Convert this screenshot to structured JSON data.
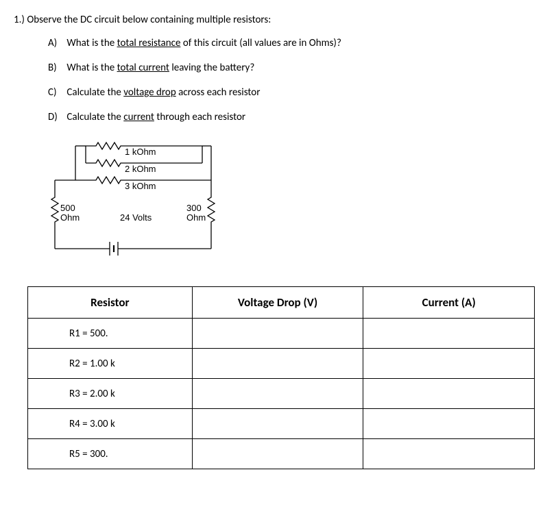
{
  "question": {
    "number_text": "1.) Observe the DC circuit below containing multiple resistors:",
    "parts": {
      "a": {
        "letter": "A)",
        "before": "What is the ",
        "underlined": "total resistance",
        "after": " of this circuit (all values are in Ohms)?"
      },
      "b": {
        "letter": "B)",
        "before": "What is the ",
        "underlined": "total current",
        "after": " leaving the battery?"
      },
      "c": {
        "letter": "C)",
        "before": "Calculate the ",
        "underlined": "voltage drop",
        "after": " across each resistor"
      },
      "d": {
        "letter": "D)",
        "before": "Calculate the ",
        "underlined": "current",
        "after": " through each resistor"
      }
    }
  },
  "circuit": {
    "labels": {
      "r_1k": "1 kOhm",
      "r_2k": "2 kOhm",
      "r_3k": "3 kOhm",
      "r_500_a": "500",
      "r_500_b": "Ohm",
      "r_300_a": "300",
      "r_300_b": "Ohm",
      "voltage": "24 Volts"
    }
  },
  "table": {
    "headers": {
      "resistor": "Resistor",
      "voltage": "Voltage Drop (V)",
      "current": "Current (A)"
    },
    "rows": [
      {
        "label": "R1 = 500."
      },
      {
        "label": "R2 = 1.00 k"
      },
      {
        "label": "R3 = 2.00 k"
      },
      {
        "label": "R4 = 3.00 k"
      },
      {
        "label": "R5 = 300."
      }
    ]
  }
}
